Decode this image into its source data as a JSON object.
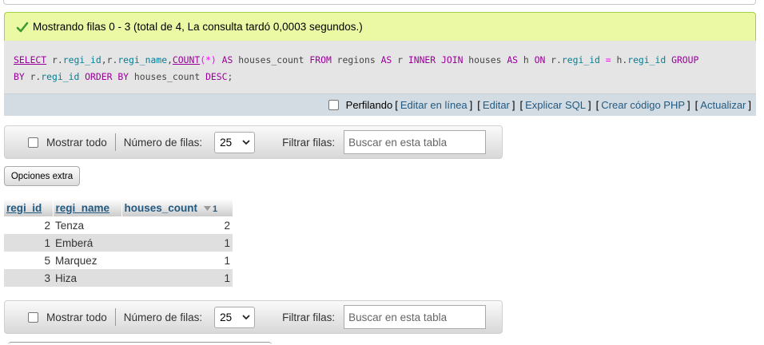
{
  "success": {
    "message": "Mostrando filas 0 - 3 (total de 4, La consulta tardó 0,0003 segundos.)"
  },
  "sql": {
    "t1": "SELECT",
    "t2": " r.",
    "t3": "regi_id",
    "t4": ",r.",
    "t5": "regi_name",
    "t6": ",",
    "t7": "COUNT",
    "t8": "(*)",
    "t9": " AS ",
    "t10": "houses_count ",
    "t11": "FROM",
    "t12": " regions ",
    "t13": "AS",
    "t14": " r ",
    "t15": "INNER JOIN",
    "t16": " houses ",
    "t17": "AS",
    "t18": " h ",
    "t19": "ON",
    "t20": " r.",
    "t21": "regi_id",
    "t22": " = ",
    "t23": "h.",
    "t24": "regi_id",
    "t25": " GROUP",
    "t26": "BY",
    "t27": " r.",
    "t28": "regi_id",
    "t29": " ORDER BY",
    "t30": " houses_count ",
    "t31": "DESC",
    "t32": ";"
  },
  "toolbar": {
    "profiling_label": "Perfilando",
    "edit_inline": "Editar en línea",
    "edit": "Editar",
    "explain_sql": "Explicar SQL",
    "create_php": "Crear código PHP",
    "refresh": "Actualizar",
    "open_bracket": "[",
    "close_bracket": "]"
  },
  "navigation": {
    "show_all_label": "Mostrar todo",
    "rows_label": "Número de filas:",
    "rows_value": "25",
    "filter_label": "Filtrar filas:",
    "search_placeholder": "Buscar en esta tabla"
  },
  "extra_options_label": "Opciones extra",
  "table": {
    "headers": [
      "regi_id",
      "regi_name",
      "houses_count"
    ],
    "sort_index": "1",
    "rows": [
      {
        "regi_id": "2",
        "regi_name": "Tenza",
        "houses_count": "2"
      },
      {
        "regi_id": "1",
        "regi_name": "Emberá",
        "houses_count": "1"
      },
      {
        "regi_id": "5",
        "regi_name": "Marquez",
        "houses_count": "1"
      },
      {
        "regi_id": "3",
        "regi_name": "Hiza",
        "houses_count": "1"
      }
    ]
  },
  "colors": {
    "success_bg": "#ebf8a4",
    "link": "#235a81",
    "sql_keyword": "#990099"
  }
}
